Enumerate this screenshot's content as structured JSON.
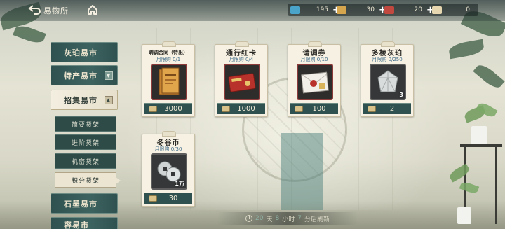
{
  "header": {
    "back_icon": "back-arrow-icon",
    "title": "易物所",
    "home_icon": "home-icon"
  },
  "resources": [
    {
      "icon": "blue-ticket-icon",
      "color": "#4aa3c9",
      "value": "195",
      "plus": "+"
    },
    {
      "icon": "gold-ticket-icon",
      "color": "#d6a64f",
      "value": "30",
      "plus": "+"
    },
    {
      "icon": "red-ticket-icon",
      "color": "#c0483e",
      "value": "20",
      "plus": "+"
    },
    {
      "icon": "paper-ticket-icon",
      "color": "#e7d7b0",
      "value": "0",
      "plus": ""
    }
  ],
  "sidebar": {
    "main": [
      {
        "label": "灰珀易市",
        "active": false
      },
      {
        "label": "特产易市",
        "active": false,
        "arrow": "▼"
      },
      {
        "label": "招集易市",
        "active": true,
        "arrow": "▲"
      }
    ],
    "sub": [
      {
        "label": "简要货架",
        "active": false
      },
      {
        "label": "进阶货架",
        "active": false
      },
      {
        "label": "机密货架",
        "active": false
      },
      {
        "label": "积分货架",
        "active": true
      }
    ],
    "more": [
      {
        "label": "石墨易市"
      },
      {
        "label": "容易市"
      }
    ]
  },
  "cards": [
    {
      "name": "聘调合同（特出）",
      "limit": "月限购 0/1",
      "price": "3000",
      "qty": "",
      "item_icon": "contract-icon"
    },
    {
      "name": "通行红卡",
      "limit": "月限购 0/4",
      "price": "1000",
      "qty": "",
      "item_icon": "red-pass-card-icon"
    },
    {
      "name": "请调券",
      "limit": "月限购 0/10",
      "price": "100",
      "qty": "",
      "item_icon": "sealed-envelope-icon"
    },
    {
      "name": "多棱灰珀",
      "limit": "月限购 0/250",
      "price": "2",
      "qty": "3",
      "item_icon": "prism-crystal-icon"
    },
    {
      "name": "冬谷币",
      "limit": "月限购 0/30",
      "price": "30",
      "qty": "1万",
      "item_icon": "coins-icon"
    }
  ],
  "refresh": {
    "icon": "clock-icon",
    "days": "20",
    "day_unit": "天",
    "hours": "8",
    "hour_unit": "小时",
    "minutes": "7",
    "minute_unit": "分后刷新"
  }
}
